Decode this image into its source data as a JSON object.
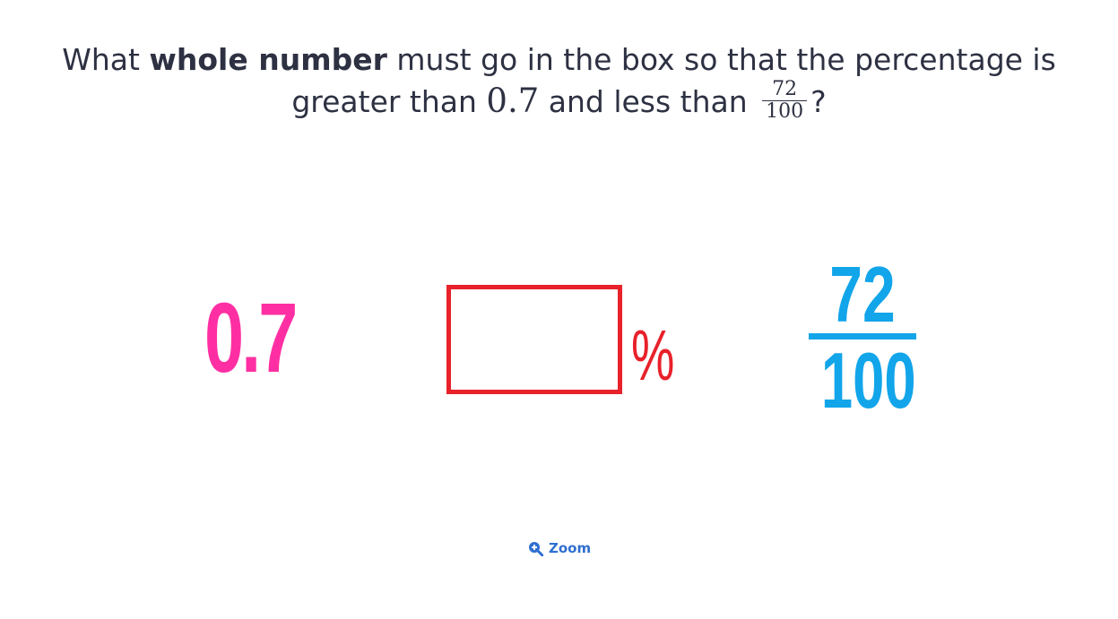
{
  "question": {
    "part1": "What ",
    "bold": "whole number",
    "part2": " must go in the box so that the percentage is",
    "part3": "greater than ",
    "decimal_value": "0.7",
    "part4": " and less than ",
    "fraction_numerator": "72",
    "fraction_denominator": "100",
    "part5": "?"
  },
  "visual": {
    "decimal": "0.7",
    "percent_sign": "%",
    "fraction_numerator": "72",
    "fraction_denominator": "100"
  },
  "zoom": {
    "icon": "zoom-in-icon",
    "label": "Zoom"
  },
  "colors": {
    "decimal": "#ff2fa3",
    "answer_box": "#e8212a",
    "percent": "#e8212a",
    "fraction": "#12a5ea",
    "zoom": "#2f6fd1"
  }
}
